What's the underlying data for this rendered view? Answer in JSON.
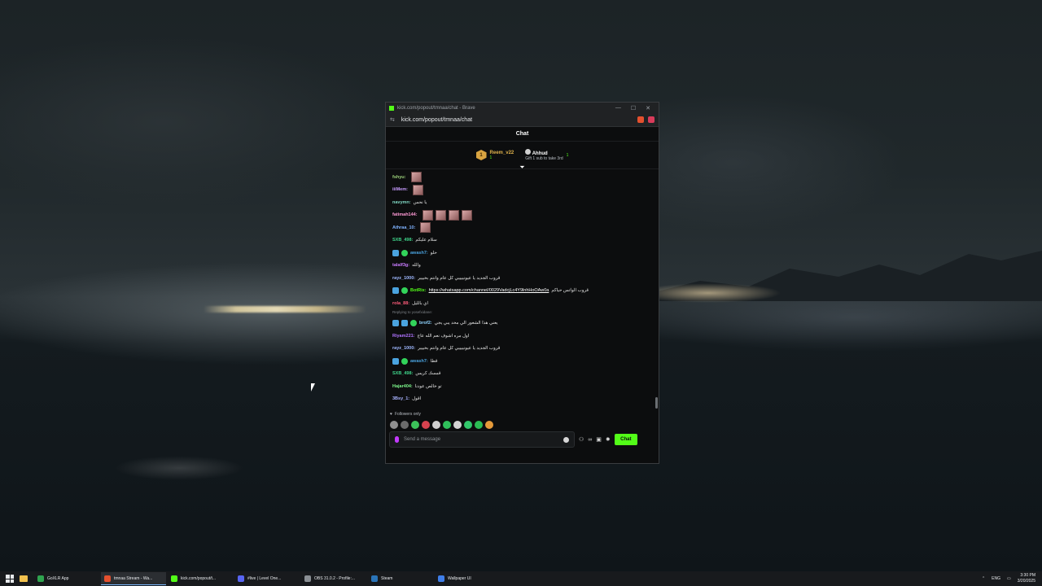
{
  "browser": {
    "window_title": "kick.com/popout/tmnaa/chat - Brave",
    "url": "kick.com/popout/tmnaa/chat",
    "controls": {
      "minimize": "—",
      "maximize": "☐",
      "close": "✕"
    }
  },
  "chat": {
    "header": "Chat",
    "top_gifters": [
      {
        "rank": "1",
        "name": "Reem_v22",
        "count": "1"
      },
      {
        "name": "Ahhud",
        "count": "1",
        "note": "Gift 1 sub to take 3rd"
      }
    ],
    "messages": [
      {
        "user": "fshyu:",
        "color": "#9bd07a",
        "text": "",
        "emotes": 1
      },
      {
        "user": "iiiMem:",
        "color": "#c89cff",
        "text": "",
        "emotes": 1
      },
      {
        "user": "navymn:",
        "color": "#7fd6c2",
        "text": "يا نحس",
        "emotes": 0
      },
      {
        "user": "fatimah144:",
        "color": "#ff9ad5",
        "text": "",
        "emotes": 4
      },
      {
        "user": "Athraa_10:",
        "color": "#7fb3ff",
        "text": "",
        "emotes": 1
      },
      {
        "user": "SXB_498:",
        "color": "#3fd48a",
        "text": "سلام عليكم",
        "emotes": 0
      },
      {
        "user": "awash7:",
        "color": "#4aa3df",
        "text": "حلو",
        "emotes": 0,
        "badges": 2
      },
      {
        "user": "talalf3g:",
        "color": "#c97cff",
        "text": "والله",
        "emotes": 0
      },
      {
        "user": "rayz_1000:",
        "color": "#9fb8ff",
        "text": "قروب الجديد يا عيونييييي كل عام وانتم بخييير",
        "emotes": 0
      },
      {
        "user": "BotRix:",
        "color": "#53fc18",
        "text": "قروب الواتس حياكم",
        "link": "https://whatsapp.com/channel/0029VadcjLc4Y9lnhHoOAw0a",
        "emotes": 0,
        "badges": 2
      },
      {
        "user": "rola_88:",
        "color": "#ff5c7a",
        "text": "اي بالليل",
        "emotes": 0
      },
      {
        "user": "brof2:",
        "color": "#8fd4ff",
        "text": "يعني هذا الشعور الي محد يبي يجي",
        "emotes": 0,
        "badges": 3,
        "reply": "Replying to yosefxidane: "
      },
      {
        "user": "Riyam221:",
        "color": "#b073ff",
        "text": "اول مره اشوف نعم الله عاج",
        "emotes": 0
      },
      {
        "user": "rayz_1000:",
        "color": "#9fb8ff",
        "text": "قروب الجديد يا عيونييييي كل عام وانتم بخييير",
        "emotes": 0
      },
      {
        "user": "awash7:",
        "color": "#4aa3df",
        "text": "قطا",
        "emotes": 0,
        "badges": 2
      },
      {
        "user": "SXB_498:",
        "color": "#3fd48a",
        "text": "قمسك كريس",
        "emotes": 0
      },
      {
        "user": "Hajar404:",
        "color": "#7cf58a",
        "text": "تو خالص عودنا",
        "emotes": 0
      },
      {
        "user": "3Bsy_1:",
        "color": "#a9b3ff",
        "text": "اقول",
        "emotes": 0
      }
    ],
    "followers_only": "Followers only",
    "input_placeholder": "Send a message",
    "send_button": "Chat"
  },
  "taskbar": {
    "items": [
      {
        "label": "GoXLR App",
        "color": "#2fa44f"
      },
      {
        "label": "tmnaa Stream - Wa...",
        "color": "#e4502e",
        "active": true
      },
      {
        "label": "kick.com/popout/t...",
        "color": "#53fc18"
      },
      {
        "label": "#live | Level One...",
        "color": "#5865f2"
      },
      {
        "label": "OBS 31.0.2 - Profile:...",
        "color": "#8a8f94"
      },
      {
        "label": "Steam",
        "color": "#2a74b8"
      },
      {
        "label": "Wallpaper UI",
        "color": "#3f7ee8"
      }
    ],
    "lang": "ENG",
    "time": "3:30 PM",
    "date": "3/20/2025"
  },
  "colors": {
    "kick_green": "#53fc18"
  }
}
